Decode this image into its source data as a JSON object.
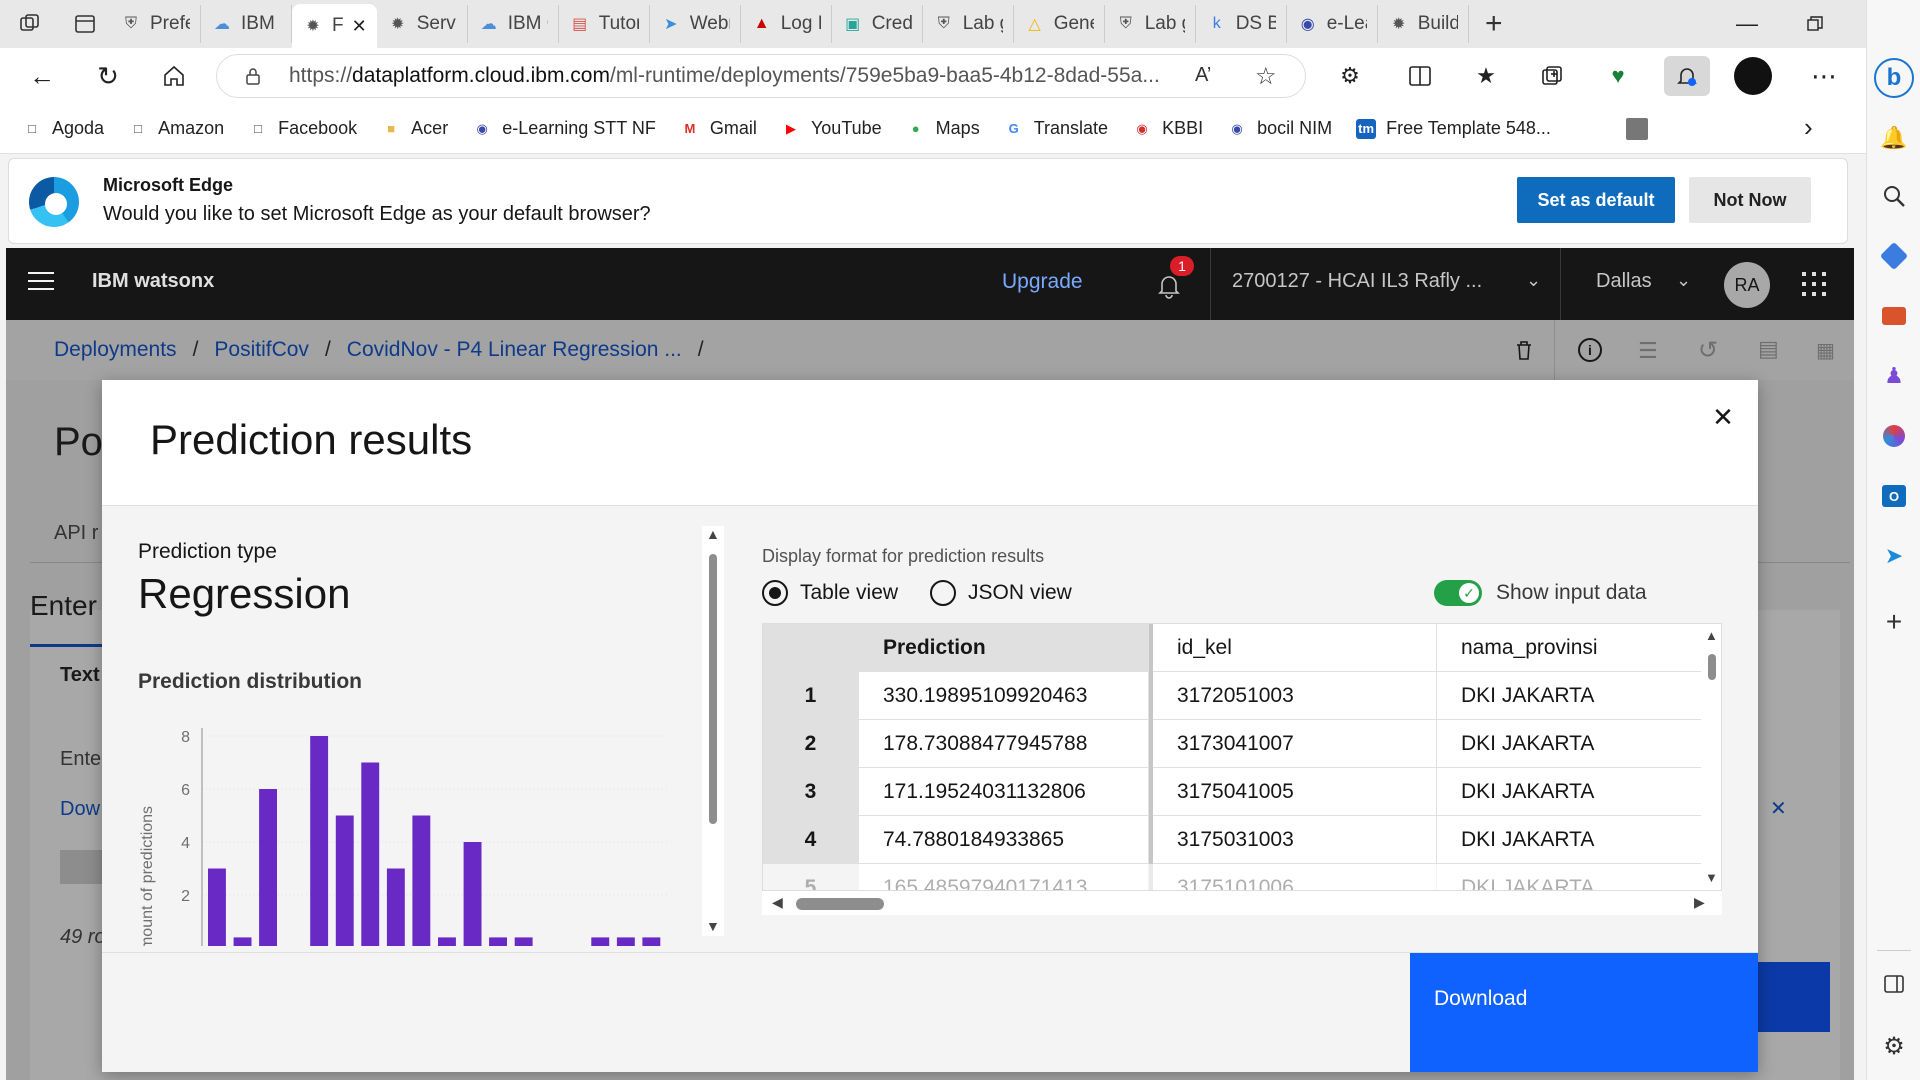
{
  "browser": {
    "tabs": [
      {
        "label": "Prefe",
        "icon": "shield-icon"
      },
      {
        "label": "IBM C",
        "icon": "cloud-icon"
      },
      {
        "label": "F",
        "icon": "deploy-icon",
        "active": true
      },
      {
        "label": "Servi",
        "icon": "deploy-icon"
      },
      {
        "label": "IBM C",
        "icon": "cloud-icon"
      },
      {
        "label": "Tutor",
        "icon": "pdf-icon"
      },
      {
        "label": "Webr",
        "icon": "paper-plane-icon"
      },
      {
        "label": "Log I",
        "icon": "redhat-icon"
      },
      {
        "label": "Credl",
        "icon": "credly-icon"
      },
      {
        "label": "Lab g",
        "icon": "shield-icon"
      },
      {
        "label": "Gene",
        "icon": "drive-icon"
      },
      {
        "label": "Lab g",
        "icon": "shield-icon"
      },
      {
        "label": "DS B",
        "icon": "k-icon"
      },
      {
        "label": "e-Lea",
        "icon": "globe-icon"
      },
      {
        "label": "Build",
        "icon": "deploy-icon"
      }
    ],
    "url_prefix": "https://",
    "url_domain": "dataplatform.cloud.ibm.com",
    "url_path": "/ml-runtime/deployments/759e5ba9-baa5-4b12-8dad-55a...",
    "bookmarks": [
      {
        "label": "Agoda",
        "icon": "page-icon"
      },
      {
        "label": "Amazon",
        "icon": "page-icon"
      },
      {
        "label": "Facebook",
        "icon": "page-icon"
      },
      {
        "label": "Acer",
        "icon": "folder-icon"
      },
      {
        "label": "e-Learning STT NF",
        "icon": "globe-icon"
      },
      {
        "label": "Gmail",
        "icon": "gmail-icon"
      },
      {
        "label": "YouTube",
        "icon": "youtube-icon"
      },
      {
        "label": "Maps",
        "icon": "maps-icon"
      },
      {
        "label": "Translate",
        "icon": "translate-icon"
      },
      {
        "label": "KBBI",
        "icon": "kbbi-icon"
      },
      {
        "label": "bocil NIM",
        "icon": "globe-icon"
      },
      {
        "label": "Free Template 548...",
        "icon": "tm-icon"
      }
    ],
    "infobar": {
      "title": "Microsoft Edge",
      "message": "Would you like to set Microsoft Edge as your default browser?",
      "primary": "Set as default",
      "secondary": "Not Now"
    }
  },
  "app": {
    "brand": "IBM watsonx",
    "upgrade": "Upgrade",
    "notif_count": "1",
    "account": "2700127 - HCAI IL3 Rafly ...",
    "region": "Dallas",
    "avatar": "RA",
    "breadcrumb": [
      "Deployments",
      "PositifCov",
      "CovidNov - P4 Linear Regression ..."
    ],
    "breadcrumb_sep": "/",
    "bg_title": "Po",
    "bg_tab": "API r",
    "bg_enter": "Enter",
    "bg_text": "Text",
    "bg_enter2": "Ente",
    "bg_down": "Dow",
    "bg_rows": "49 ro"
  },
  "modal": {
    "title": "Prediction results",
    "prediction_type_label": "Prediction type",
    "prediction_type": "Regression",
    "dist_title": "Prediction distribution",
    "display_format_label": "Display format for prediction results",
    "table_view": "Table view",
    "json_view": "JSON view",
    "show_input": "Show input data",
    "download": "Download"
  },
  "chart_data": {
    "type": "bar",
    "values": [
      3,
      0.4,
      6,
      0,
      8,
      5,
      7,
      3,
      5,
      0.4,
      4,
      0.4,
      0.4,
      0,
      0,
      0.4,
      0.4,
      0.4
    ],
    "ylabel": "mount of predictions",
    "yticks": [
      2,
      4,
      6,
      8
    ],
    "ylim": [
      0,
      8.3
    ],
    "color": "#6929c4"
  },
  "table": {
    "headers": [
      "Prediction",
      "id_kel",
      "nama_provinsi"
    ],
    "rows": [
      {
        "n": "1",
        "prediction": "330.19895109920463",
        "id_kel": "3172051003",
        "provinsi": "DKI JAKARTA"
      },
      {
        "n": "2",
        "prediction": "178.73088477945788",
        "id_kel": "3173041007",
        "provinsi": "DKI JAKARTA"
      },
      {
        "n": "3",
        "prediction": "171.19524031132806",
        "id_kel": "3175041005",
        "provinsi": "DKI JAKARTA"
      },
      {
        "n": "4",
        "prediction": "74.7880184933865",
        "id_kel": "3175031003",
        "provinsi": "DKI JAKARTA"
      },
      {
        "n": "5",
        "prediction": "165.48597940171413",
        "id_kel": "3175101006",
        "provinsi": "DKI JAKARTA"
      }
    ]
  },
  "colors": {
    "ibm_blue": "#0f62fe",
    "toggle_green": "#24a148",
    "header_bg": "#161616",
    "bar_purple": "#6929c4"
  }
}
